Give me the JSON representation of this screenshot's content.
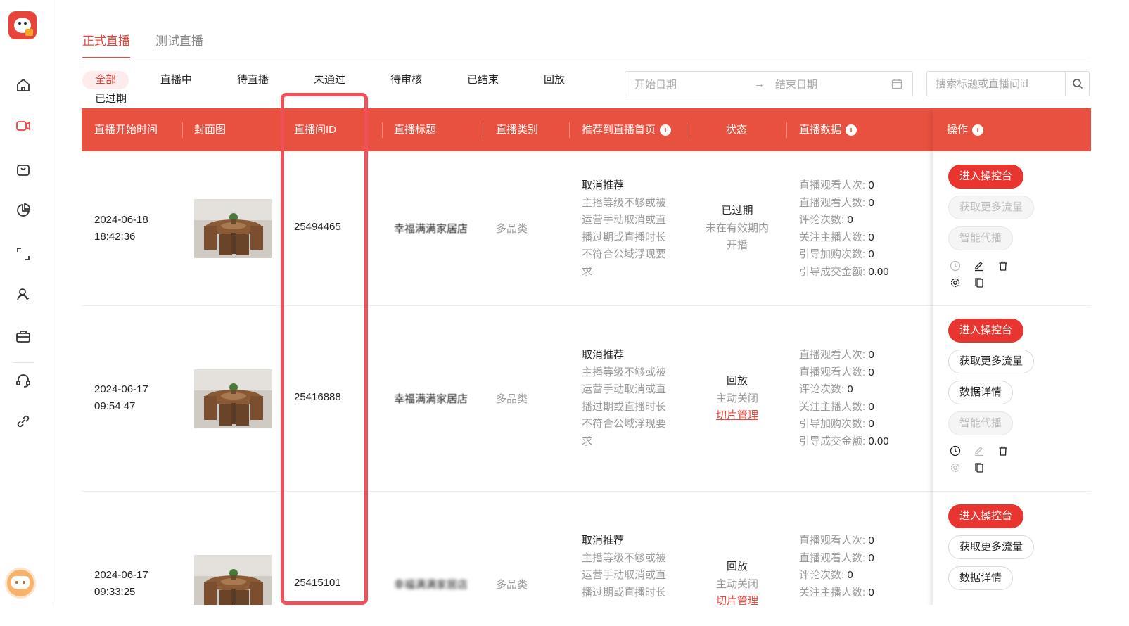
{
  "main_tabs": [
    {
      "label": "正式直播",
      "active": true
    },
    {
      "label": "测试直播",
      "active": false
    }
  ],
  "filters": [
    "全部",
    "直播中",
    "待直播",
    "未通过",
    "待审核",
    "已结束",
    "回放",
    "已过期"
  ],
  "active_filter": "全部",
  "date_range": {
    "start_placeholder": "开始日期",
    "arrow": "→",
    "end_placeholder": "结束日期"
  },
  "search": {
    "placeholder": "搜索标题或直播间id"
  },
  "table": {
    "headers": [
      "直播开始时间",
      "封面图",
      "直播间ID",
      "直播标题",
      "直播类别",
      "推荐到直播首页",
      "状态",
      "直播数据",
      "操作"
    ],
    "data_labels": [
      "直播观看人次:",
      "直播观看人数:",
      "评论次数:",
      "关注主播人数:",
      "引导加购次数:",
      "引导成交金额:"
    ],
    "rows": [
      {
        "date": "2024-06-18",
        "time": "18:42:36",
        "room_id": "25494465",
        "title": "幸福满满家居店",
        "category": "多品类",
        "recommend_title": "取消推荐",
        "recommend_lines": [
          "主播等级不够或被",
          "运营手动取消或直",
          "播过期或直播时长",
          "不符合公域浮现要",
          "求"
        ],
        "status_main": "已过期",
        "status_sub_lines": [
          "未在有效期内",
          "开播"
        ],
        "status_link": "",
        "data_values": [
          "0",
          "0",
          "0",
          "0",
          "0",
          "0.00"
        ],
        "buttons": [
          "进入操控台",
          "获取更多流量",
          "智能代播"
        ]
      },
      {
        "date": "2024-06-17",
        "time": "09:54:47",
        "room_id": "25416888",
        "title": "幸福满满家居店",
        "category": "多品类",
        "recommend_title": "取消推荐",
        "recommend_lines": [
          "主播等级不够或被",
          "运营手动取消或直",
          "播过期或直播时长",
          "不符合公域浮现要",
          "求"
        ],
        "status_main": "回放",
        "status_sub_lines": [
          "主动关闭"
        ],
        "status_link": "切片管理",
        "data_values": [
          "0",
          "0",
          "0",
          "0",
          "0",
          "0.00"
        ],
        "buttons": [
          "进入操控台",
          "获取更多流量",
          "数据详情",
          "智能代播"
        ]
      },
      {
        "date": "2024-06-17",
        "time": "09:33:25",
        "room_id": "25415101",
        "title": "幸福满满家居店",
        "category": "多品类",
        "recommend_title": "取消推荐",
        "recommend_lines": [
          "主播等级不够或被",
          "运营手动取消或直",
          "播过期或直播时长"
        ],
        "status_main": "回放",
        "status_sub_lines": [
          "主动关闭"
        ],
        "status_link": "切片管理",
        "data_values": [
          "0",
          "0",
          "0",
          "0"
        ],
        "buttons": [
          "进入操控台",
          "获取更多流量",
          "数据详情"
        ]
      }
    ]
  },
  "colors": {
    "accent": "#e8443a",
    "header_bg": "#e8503f",
    "highlight": "#f0505a"
  },
  "sidebar_icons": [
    "home-icon",
    "live-video-icon",
    "shopping-bag-icon",
    "pie-chart-icon",
    "scan-icon",
    "user-icon",
    "toolbox-icon",
    "headset-icon",
    "link-icon"
  ]
}
